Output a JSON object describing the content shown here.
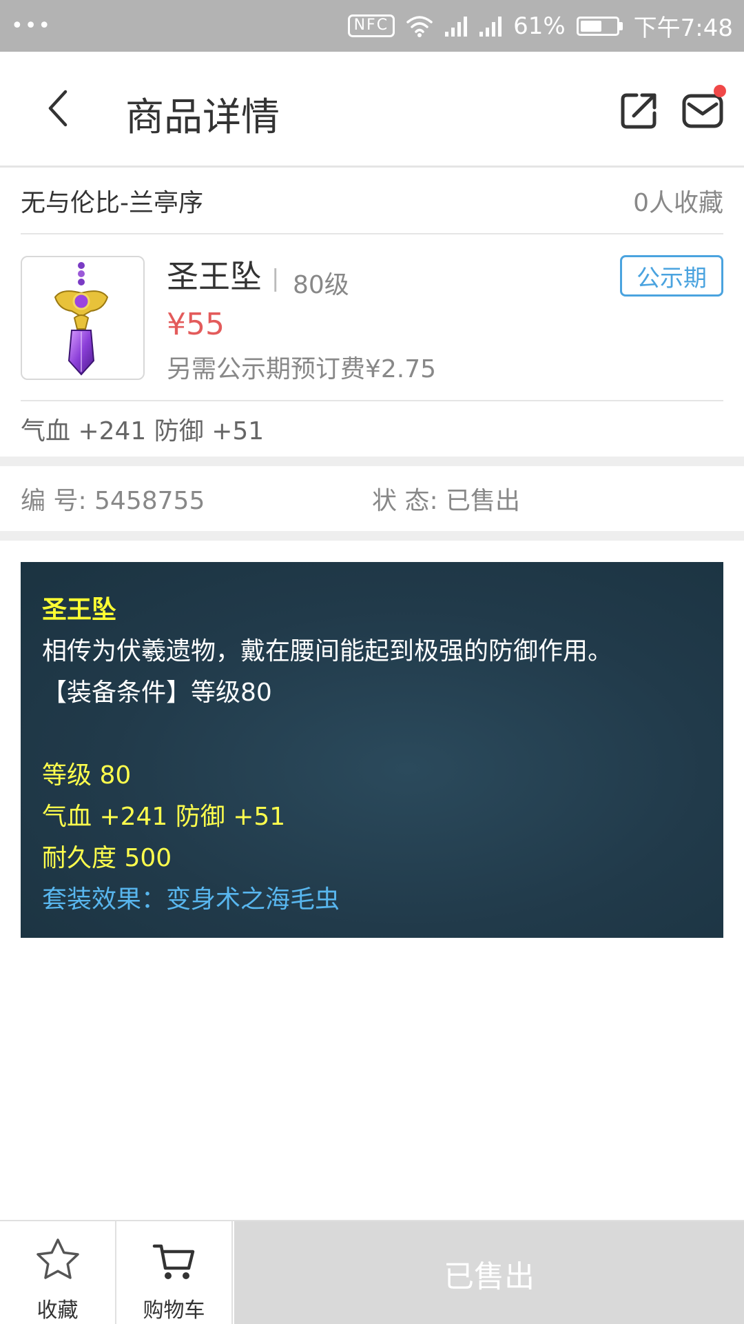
{
  "status_bar": {
    "menu_dots": "•••",
    "nfc": "NFC",
    "battery_percent": "61%",
    "battery_level": 0.61,
    "time": "下午7:48"
  },
  "header": {
    "title": "商品详情",
    "icons": [
      "back-icon",
      "share-icon",
      "mail-icon"
    ],
    "notification_dot_color": "#f04848"
  },
  "seller": {
    "name": "无与伦比-兰亭序",
    "favorites": "0人收藏"
  },
  "product": {
    "name": "圣王坠",
    "separator": "|",
    "level": "80级",
    "price": "¥55",
    "extra_fee": "另需公示期预订费¥2.75",
    "badge": "公示期",
    "attributes": "气血 +241 防御 +51",
    "price_color": "#e35b5b",
    "badge_color": "#4aa3df"
  },
  "info": {
    "id_label": "编 号:",
    "id_value": "5458755",
    "status_label": "状 态:",
    "status_value": "已售出"
  },
  "detail": {
    "name": "圣王坠",
    "description": "相传为伏羲遗物，戴在腰间能起到极强的防御作用。",
    "requirement": "【装备条件】等级80",
    "level": "等级 80",
    "stats": "气血 +241 防御 +51",
    "durability": "耐久度 500",
    "set_effect": "套装效果：变身术之海毛虫"
  },
  "bottom_bar": {
    "favorite_label": "收藏",
    "cart_label": "购物车",
    "sold_label": "已售出"
  }
}
